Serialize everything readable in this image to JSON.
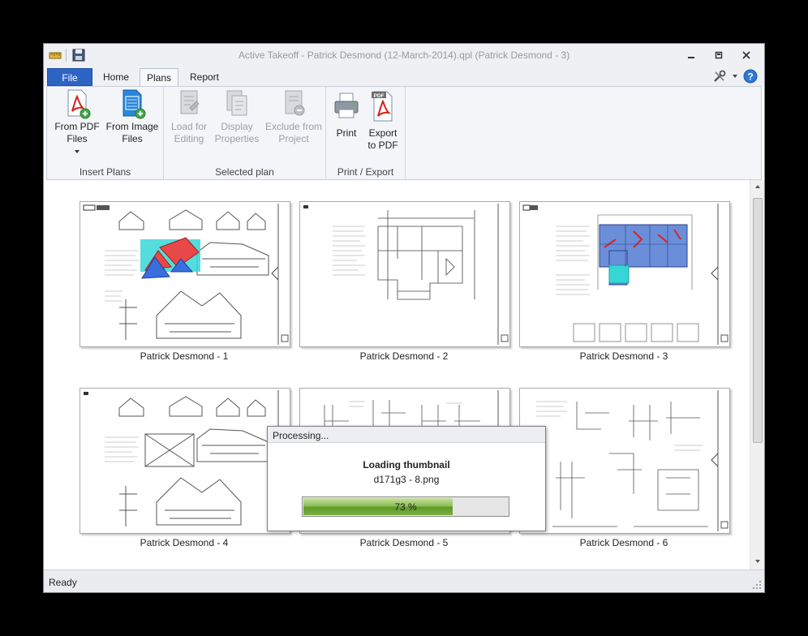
{
  "window": {
    "title": "Active Takeoff - Patrick Desmond (12-March-2014).qpl (Patrick Desmond - 3)"
  },
  "tabs": [
    {
      "label": "File"
    },
    {
      "label": "Home"
    },
    {
      "label": "Plans"
    },
    {
      "label": "Report"
    }
  ],
  "ribbon": {
    "insert_plans": {
      "label": "Insert Plans",
      "from_pdf": {
        "line1": "From PDF",
        "line2": "Files"
      },
      "from_image": {
        "line1": "From Image",
        "line2": "Files"
      }
    },
    "selected_plan": {
      "label": "Selected plan",
      "load": {
        "line1": "Load for",
        "line2": "Editing"
      },
      "display": {
        "line1": "Display",
        "line2": "Properties"
      },
      "exclude": {
        "line1": "Exclude from",
        "line2": "Project"
      }
    },
    "print_export": {
      "label": "Print / Export",
      "print": {
        "line1": "Print"
      },
      "export": {
        "line1": "Export",
        "line2": "to PDF"
      }
    }
  },
  "plans": [
    {
      "label": "Patrick Desmond - 1"
    },
    {
      "label": "Patrick Desmond - 2"
    },
    {
      "label": "Patrick Desmond - 3"
    },
    {
      "label": "Patrick Desmond - 4"
    },
    {
      "label": "Patrick Desmond - 5"
    },
    {
      "label": "Patrick Desmond - 6"
    }
  ],
  "dialog": {
    "title": "Processing...",
    "heading": "Loading thumbnail",
    "file": "d171g3 - 8.png",
    "progress_text": "73 %",
    "progress_value": 0.73
  },
  "status": {
    "text": "Ready"
  },
  "colors": {
    "file_tab": "#2d64c4",
    "progress": "#6aa437",
    "roof_red": "#e84848",
    "roof_blue": "#3a6fe0",
    "floor_blue": "#6a8fd8",
    "cyan": "#37d6d6"
  }
}
